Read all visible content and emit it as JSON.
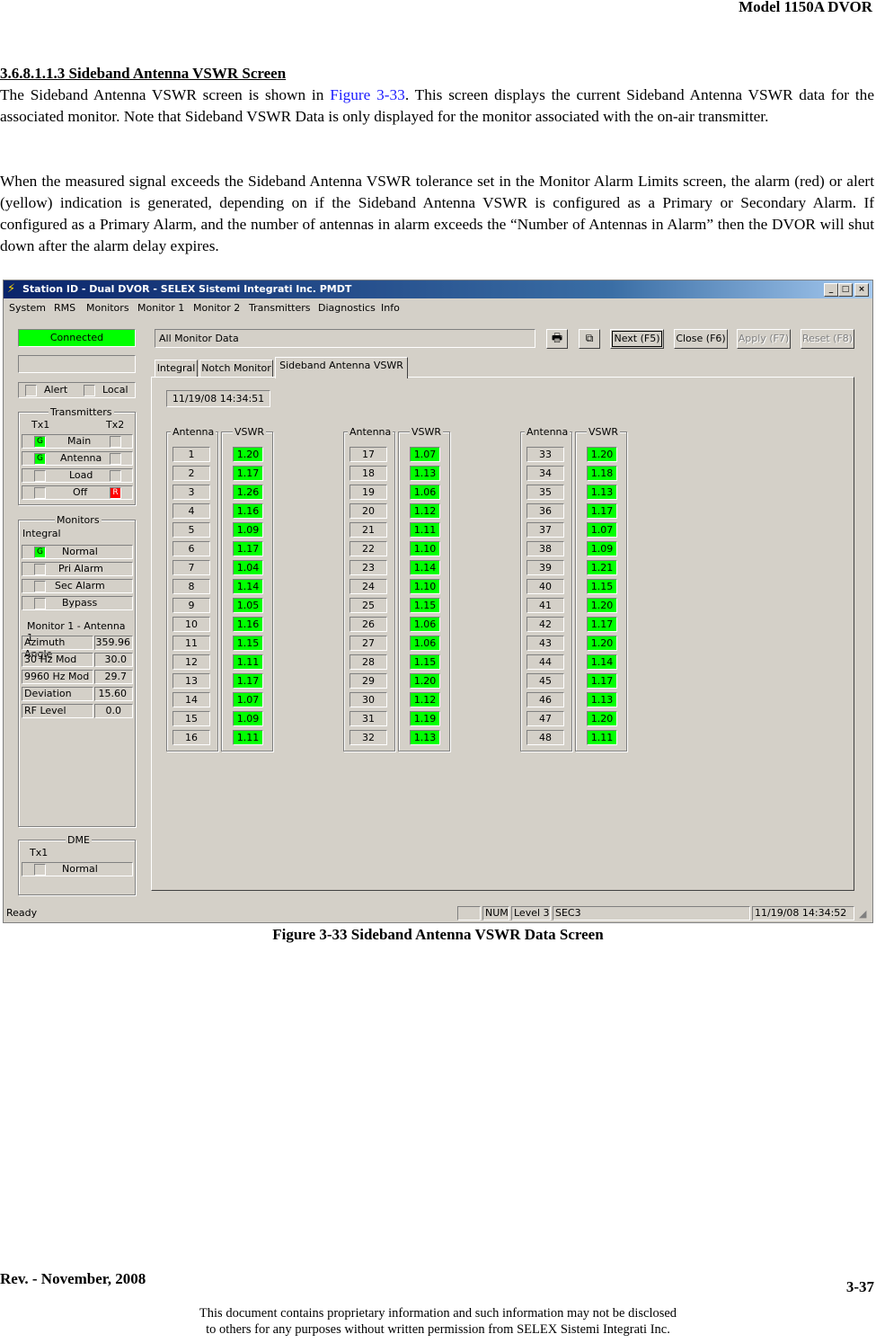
{
  "header": {
    "model": "Model 1150A DVOR"
  },
  "section": {
    "number": "3.6.8.1.1.3",
    "title": "Sideband Antenna VSWR Screen"
  },
  "para1": {
    "before": "The Sideband Antenna VSWR screen is shown in ",
    "link": "Figure 3-33",
    "after": ". This screen displays the current Sideband Antenna VSWR data for the associated monitor. Note that Sideband VSWR Data is only displayed for the monitor associated with the on-air transmitter."
  },
  "para2": "When the measured signal exceeds the Sideband Antenna VSWR tolerance set in the Monitor Alarm Limits screen, the alarm (red) or alert (yellow) indication is generated, depending on if the Sideband Antenna VSWR is configured as a Primary or Secondary Alarm. If configured as a Primary Alarm, and the number of antennas in alarm exceeds the “Number of Antennas in Alarm” then the DVOR will shut down after the alarm delay expires.",
  "window": {
    "title": "Station ID - Dual DVOR - SELEX Sistemi Integrati Inc. PMDT",
    "controls": {
      "minimize": "_",
      "maximize": "□",
      "close": "×"
    },
    "menu": [
      "System",
      "RMS",
      "Monitors",
      "Monitor 1",
      "Monitor 2",
      "Transmitters",
      "Diagnostics",
      "Info"
    ],
    "connection": "Connected",
    "data_field": "All Monitor Data",
    "buttons": {
      "next": "Next (F5)",
      "close": "Close (F6)",
      "apply": "Apply (F7)",
      "reset": "Reset (F8)"
    },
    "tabs": [
      "Integral",
      "Notch Monitor",
      "Sideband Antenna VSWR"
    ],
    "timestamp": "11/19/08 14:34:51",
    "alert_label": "Alert",
    "local_label": "Local",
    "transmitters": {
      "title": "Transmitters",
      "tx1": "Tx1",
      "tx2": "Tx2",
      "rows": [
        {
          "label": "Main",
          "tx1": "G",
          "tx2": ""
        },
        {
          "label": "Antenna",
          "tx1": "G",
          "tx2": ""
        },
        {
          "label": "Load",
          "tx1": "",
          "tx2": ""
        },
        {
          "label": "Off",
          "tx1": "",
          "tx2": "R"
        }
      ]
    },
    "monitors": {
      "title": "Monitors",
      "sub": "Integral",
      "rows": [
        {
          "label": "Normal",
          "state": "G"
        },
        {
          "label": "Pri Alarm",
          "state": ""
        },
        {
          "label": "Sec Alarm",
          "state": ""
        },
        {
          "label": "Bypass",
          "state": ""
        }
      ],
      "antenna_title": "Monitor 1 - Antenna 1",
      "readings": [
        {
          "label": "Azimuth Angle",
          "value": "359.96"
        },
        {
          "label": "30 Hz Mod",
          "value": "30.0"
        },
        {
          "label": "9960 Hz Mod",
          "value": "29.7"
        },
        {
          "label": "Deviation",
          "value": "15.60"
        },
        {
          "label": "RF Level",
          "value": "0.0"
        }
      ]
    },
    "dme": {
      "title": "DME",
      "tx": "Tx1",
      "row": "Normal"
    },
    "column_headers": {
      "antenna": "Antenna",
      "vswr": "VSWR"
    },
    "vswr_groups": [
      {
        "antennas": [
          "1",
          "2",
          "3",
          "4",
          "5",
          "6",
          "7",
          "8",
          "9",
          "10",
          "11",
          "12",
          "13",
          "14",
          "15",
          "16"
        ],
        "vswr": [
          "1.20",
          "1.17",
          "1.26",
          "1.16",
          "1.09",
          "1.17",
          "1.04",
          "1.14",
          "1.05",
          "1.16",
          "1.15",
          "1.11",
          "1.17",
          "1.07",
          "1.09",
          "1.11"
        ]
      },
      {
        "antennas": [
          "17",
          "18",
          "19",
          "20",
          "21",
          "22",
          "23",
          "24",
          "25",
          "26",
          "27",
          "28",
          "29",
          "30",
          "31",
          "32"
        ],
        "vswr": [
          "1.07",
          "1.13",
          "1.06",
          "1.12",
          "1.11",
          "1.10",
          "1.14",
          "1.10",
          "1.15",
          "1.06",
          "1.06",
          "1.15",
          "1.20",
          "1.12",
          "1.19",
          "1.13"
        ]
      },
      {
        "antennas": [
          "33",
          "34",
          "35",
          "36",
          "37",
          "38",
          "39",
          "40",
          "41",
          "42",
          "43",
          "44",
          "45",
          "46",
          "47",
          "48"
        ],
        "vswr": [
          "1.20",
          "1.18",
          "1.13",
          "1.17",
          "1.07",
          "1.09",
          "1.21",
          "1.15",
          "1.20",
          "1.17",
          "1.20",
          "1.14",
          "1.17",
          "1.13",
          "1.20",
          "1.11"
        ]
      }
    ],
    "status": {
      "ready": "Ready",
      "num": "NUM",
      "level": "Level 3",
      "sec": "SEC3",
      "time": "11/19/08 14:34:52"
    }
  },
  "caption": "Figure 3-33  Sideband Antenna VSWR Data Screen",
  "footer": {
    "rev": "Rev. -  November, 2008",
    "page": "3-37",
    "line1": "This document contains proprietary information and such information may not be disclosed",
    "line2": "to others for any purposes without written permission from SELEX Sistemi Integrati Inc."
  },
  "colors": {
    "status_green": "#00ff00",
    "alarm_red": "#ff0000",
    "title_blue": "#0a246a",
    "link_blue": "#1a1aff"
  }
}
